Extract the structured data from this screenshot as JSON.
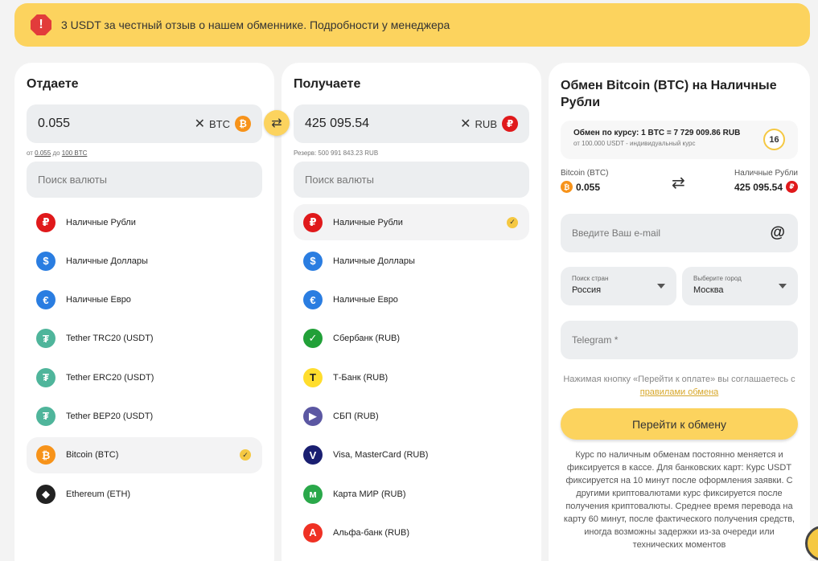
{
  "banner": {
    "text": "3 USDT за честный отзыв о нашем обменнике. Подробности у менеджера"
  },
  "give": {
    "title": "Отдаете",
    "amount": "0.055",
    "currency": "BTC",
    "limits_prefix": "от",
    "limits_min": "0.055",
    "limits_mid": "до",
    "limits_max": "100 BTC",
    "search_placeholder": "Поиск валюты",
    "items": [
      {
        "label": "Наличные Рубли",
        "icon": "ruble-icon",
        "color": "#e0191b",
        "glyph": "₽"
      },
      {
        "label": "Наличные Доллары",
        "icon": "dollar-icon",
        "color": "#2a7de1",
        "glyph": "$"
      },
      {
        "label": "Наличные Евро",
        "icon": "euro-icon",
        "color": "#2a7de1",
        "glyph": "€"
      },
      {
        "label": "Tether TRC20 (USDT)",
        "icon": "tether-icon",
        "color": "#4fb59b",
        "glyph": "₮"
      },
      {
        "label": "Tether ERC20 (USDT)",
        "icon": "tether-icon",
        "color": "#4fb59b",
        "glyph": "₮"
      },
      {
        "label": "Tether BEP20 (USDT)",
        "icon": "tether-icon",
        "color": "#4fb59b",
        "glyph": "₮"
      },
      {
        "label": "Bitcoin (BTC)",
        "icon": "bitcoin-icon",
        "color": "#f7931a",
        "glyph": "₿",
        "selected": true
      },
      {
        "label": "Ethereum (ETH)",
        "icon": "ethereum-icon",
        "color": "#222222",
        "glyph": "◆"
      }
    ]
  },
  "get": {
    "title": "Получаете",
    "amount": "425 095.54",
    "currency": "RUB",
    "reserve": "Резерв: 500 991 843.23 RUB",
    "search_placeholder": "Поиск валюты",
    "items": [
      {
        "label": "Наличные Рубли",
        "icon": "ruble-icon",
        "color": "#e0191b",
        "glyph": "₽",
        "selected": true
      },
      {
        "label": "Наличные Доллары",
        "icon": "dollar-icon",
        "color": "#2a7de1",
        "glyph": "$"
      },
      {
        "label": "Наличные Евро",
        "icon": "euro-icon",
        "color": "#2a7de1",
        "glyph": "€"
      },
      {
        "label": "Сбербанк (RUB)",
        "icon": "sberbank-icon",
        "color": "#21a038",
        "glyph": "✓"
      },
      {
        "label": "Т-Банк (RUB)",
        "icon": "tbank-icon",
        "color": "#ffdd2d",
        "glyph": "T"
      },
      {
        "label": "СБП (RUB)",
        "icon": "sbp-icon",
        "color": "#5b57a2",
        "glyph": "▶"
      },
      {
        "label": "Visa, MasterCard (RUB)",
        "icon": "visa-mastercard-icon",
        "color": "#1a1f71",
        "glyph": "V"
      },
      {
        "label": "Карта МИР (RUB)",
        "icon": "mir-icon",
        "color": "#2aa84a",
        "glyph": "м"
      },
      {
        "label": "Альфа-банк (RUB)",
        "icon": "alfabank-icon",
        "color": "#ef3124",
        "glyph": "А"
      }
    ]
  },
  "summary": {
    "title": "Обмен Bitcoin (BTC) на Наличные Рубли",
    "rate": "Обмен по курсу: 1 BTC = 7 729 009.86 RUB",
    "rate_note": "от 100.000 USDT - индивидуальный курс",
    "timer": "16",
    "from_label": "Bitcoin (BTC)",
    "from_value": "0.055",
    "to_label": "Наличные Рубли",
    "to_value": "425 095.54",
    "email_placeholder": "Введите Ваш e-mail",
    "country_label": "Поиск стран",
    "country_value": "Россия",
    "city_label": "Выберите город",
    "city_value": "Москва",
    "telegram_placeholder": "Telegram *",
    "agree_text": "Нажимая кнопку «Перейти к оплате» вы соглашаетесь с",
    "agree_link": "правилами обмена",
    "go_button": "Перейти к обмену",
    "note": "Курс по наличным обменам постоянно меняется и фиксируется в кассе. Для банковских карт: Курс USDT фиксируется на 10 минут после оформления заявки. С другими криптовалютами курс фиксируется после получения криптовалюты. Среднее время перевода на карту 60 минут, после фактического получения средств, иногда возможны задержки из-за очереди или технических моментов"
  }
}
